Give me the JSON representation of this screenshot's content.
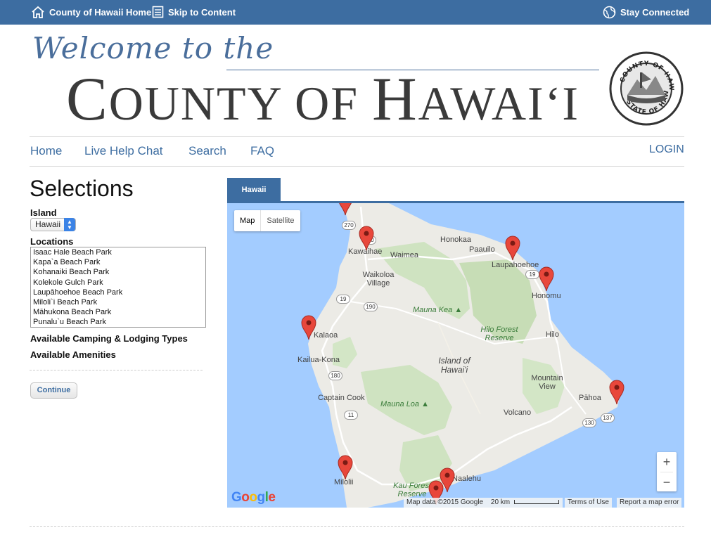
{
  "topbar": {
    "home_link": "County of Hawaii Home",
    "skip_link": "Skip to Content",
    "stay_connected": "Stay Connected"
  },
  "header": {
    "welcome": "Welcome to the",
    "title_prefix": "C",
    "title_mid": "OUNTY OF ",
    "title_h": "H",
    "title_rest": "AWAI‘I"
  },
  "nav": {
    "home": "Home",
    "live_help": "Live Help Chat",
    "search": "Search",
    "faq": "FAQ",
    "login": "LOGIN"
  },
  "selections": {
    "title": "Selections",
    "island_label": "Island",
    "island_value": "Hawaii",
    "locations_label": "Locations",
    "locations": [
      "Isaac Hale Beach Park",
      "Kapa`a Beach Park",
      "Kohanaiki Beach Park",
      "Kolekole Gulch Park",
      "Laupāhoehoe Beach Park",
      "Miloli`i Beach Park",
      "Māhukona Beach Park",
      "Punalu`u Beach Park"
    ],
    "camping_label": "Available Camping & Lodging Types",
    "amenities_label": "Available Amenities",
    "continue": "Continue"
  },
  "map": {
    "tab": "Hawaii",
    "map_btn": "Map",
    "satellite_btn": "Satellite",
    "zoom_in": "+",
    "zoom_out": "−",
    "google": "Google",
    "attrib_data": "Map data ©2015 Google",
    "scale": "20 km",
    "terms": "Terms of Use",
    "report": "Report a map error",
    "towns": [
      "Honokaa",
      "Paauilo",
      "Waimea",
      "Kawaihae",
      "Waikoloa Village",
      "Laupahoehoe",
      "Honomu",
      "Hilo",
      "Kalaoa",
      "Kailua-Kona",
      "Captain Cook",
      "Mountain View",
      "Pāhoa",
      "Volcano",
      "Milolii",
      "Naalehu"
    ],
    "parks": [
      "Mauna Kea",
      "Hilo Forest Reserve",
      "Mauna Loa",
      "Kau Forest Reserve"
    ],
    "island_name": "Island of Hawai'i",
    "highways": [
      "250",
      "270",
      "19",
      "190",
      "19",
      "180",
      "11",
      "130",
      "137"
    ]
  }
}
